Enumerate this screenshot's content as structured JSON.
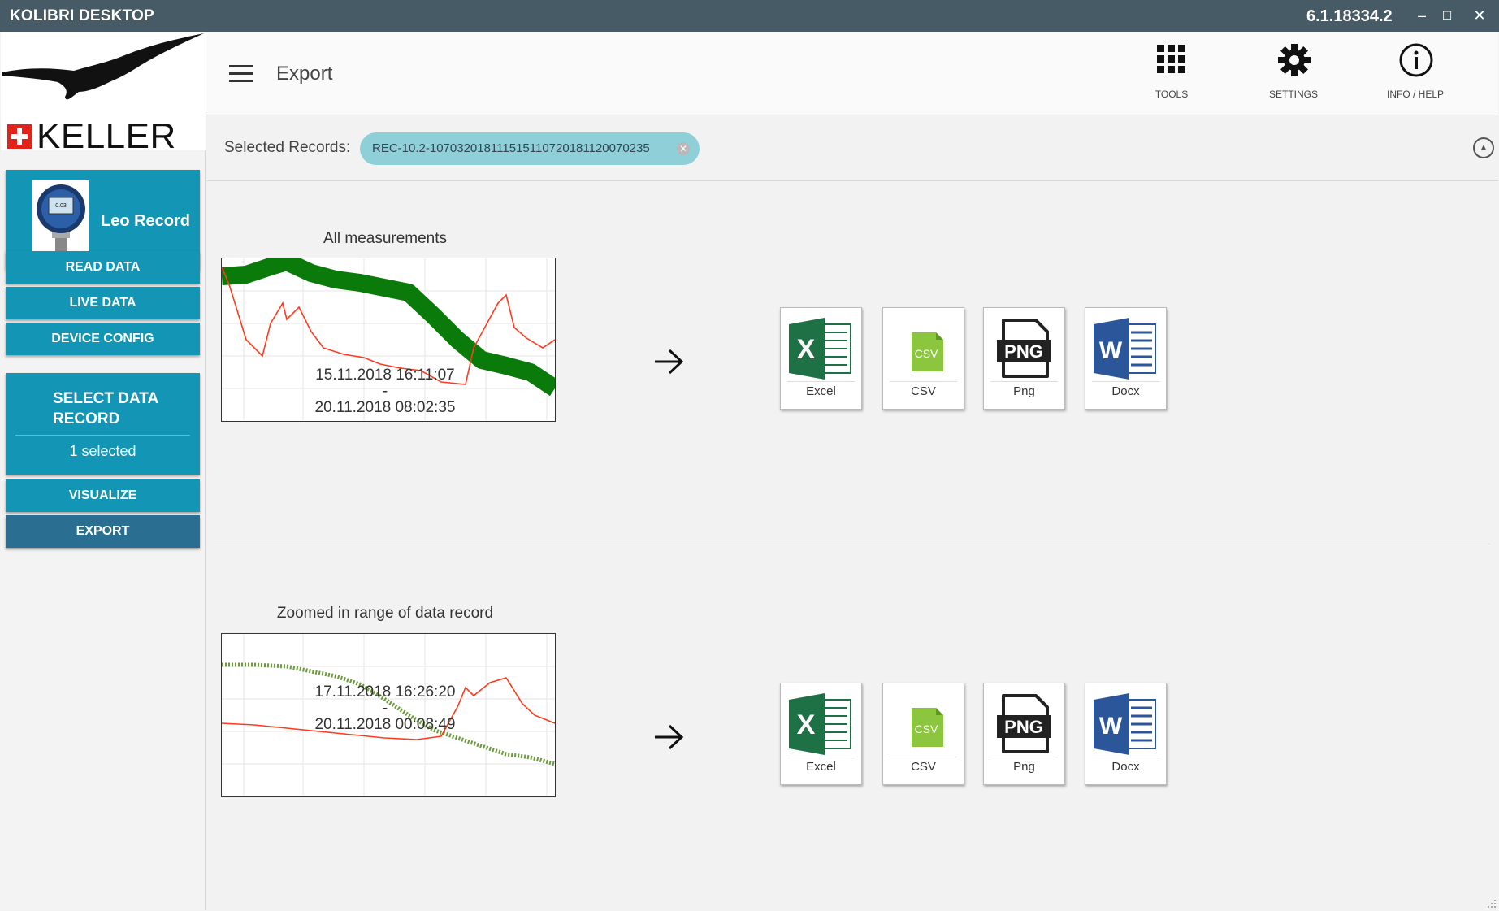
{
  "window": {
    "title": "KOLIBRI DESKTOP",
    "version": "6.1.18334.2",
    "minimize": "–",
    "maximize": "☐",
    "close": "✕"
  },
  "sidebar": {
    "brand": "KELLER",
    "device": {
      "name": "Leo Record"
    },
    "buttons": {
      "read_data": "READ DATA",
      "live_data": "LIVE DATA",
      "device_config": "DEVICE CONFIG",
      "visualize": "VISUALIZE",
      "export": "EXPORT"
    },
    "select_record": {
      "title": "SELECT DATA RECORD",
      "count": "1 selected"
    }
  },
  "header": {
    "title": "Export",
    "tools": [
      {
        "label": "TOOLS",
        "icon": "grid-icon"
      },
      {
        "label": "SETTINGS",
        "icon": "gear-icon"
      },
      {
        "label": "INFO / HELP",
        "icon": "info-icon"
      }
    ]
  },
  "records": {
    "label": "Selected Records:",
    "chip": "REC-10.2-10703201811151511072018112007023​5"
  },
  "sections": [
    {
      "title": "All measurements",
      "start": "15.11.2018 16:11:07",
      "separator": "-",
      "end": "20.11.2018 08:02:35"
    },
    {
      "title": "Zoomed in range of data record",
      "start": "17.11.2018 16:26:20",
      "separator": "-",
      "end": "20.11.2018 00:08:49"
    }
  ],
  "export_formats": [
    {
      "label": "Excel",
      "icon": "excel-icon",
      "color": "#1e7145"
    },
    {
      "label": "CSV",
      "icon": "csv-icon",
      "color": "#8cc63f"
    },
    {
      "label": "Png",
      "icon": "png-icon",
      "color": "#222222"
    },
    {
      "label": "Docx",
      "icon": "word-icon",
      "color": "#2b579a"
    }
  ],
  "colors": {
    "titlebar": "#475b66",
    "accent": "#1395b5",
    "active": "#2a6f92",
    "chip": "#8ecfd8",
    "series_green": "#0a7a0a",
    "series_red": "#ff3b1f"
  }
}
